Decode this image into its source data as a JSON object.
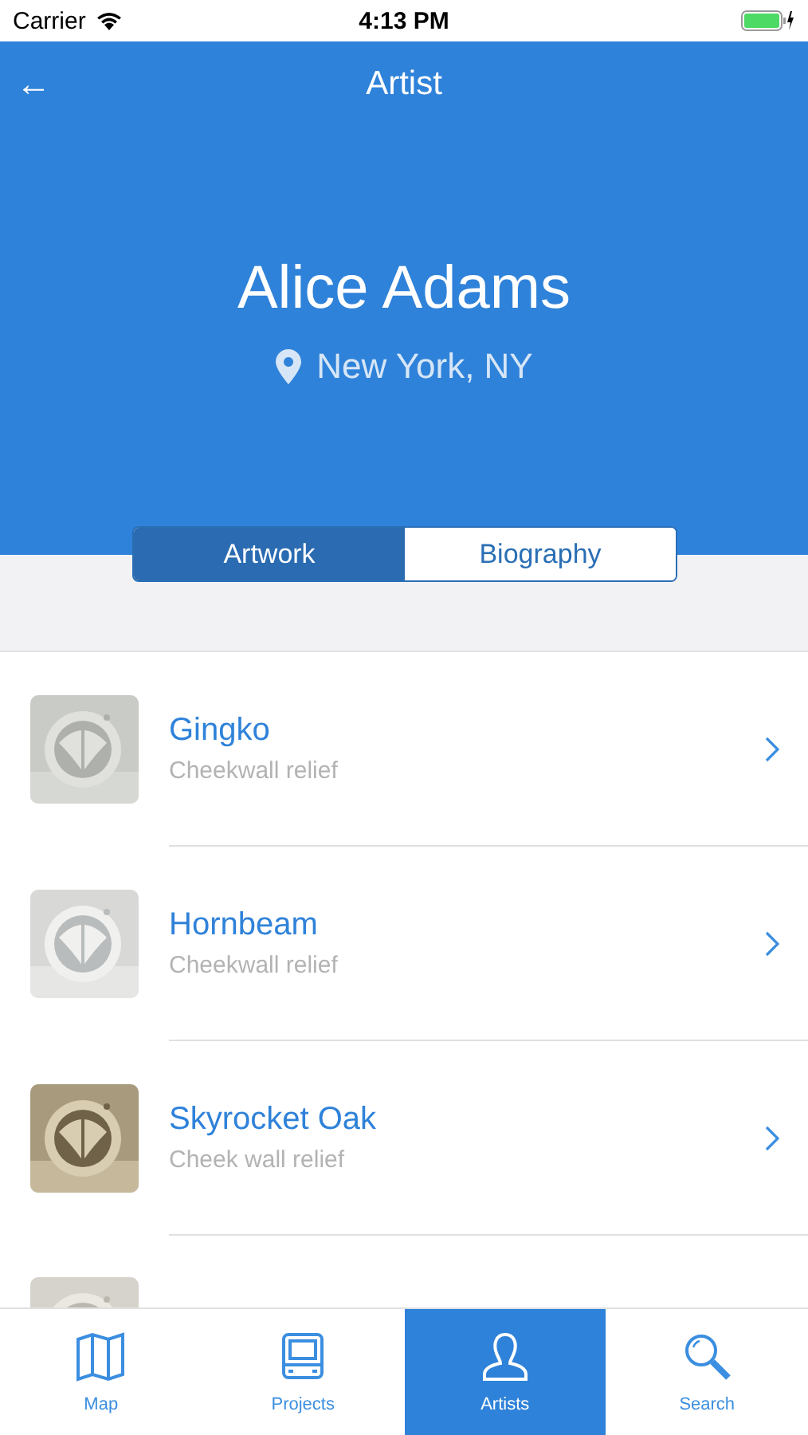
{
  "status_bar": {
    "carrier": "Carrier",
    "time": "4:13 PM"
  },
  "nav": {
    "back": "←",
    "title": "Artist"
  },
  "artist": {
    "name": "Alice Adams",
    "location": "New York, NY"
  },
  "segments": [
    {
      "label": "Artwork",
      "selected": true
    },
    {
      "label": "Biography",
      "selected": false
    }
  ],
  "artworks": [
    {
      "kind": "row",
      "title": "Gingko",
      "subtitle": "Cheekwall relief"
    },
    {
      "kind": "row",
      "title": "Hornbeam",
      "subtitle": "Cheekwall relief"
    },
    {
      "kind": "row",
      "title": "Skyrocket Oak",
      "subtitle": "Cheek wall relief"
    },
    {
      "kind": "partial"
    }
  ],
  "tab_bar": [
    {
      "label": "Map",
      "kind": "map",
      "selected": false
    },
    {
      "label": "Projects",
      "kind": "bus",
      "selected": false
    },
    {
      "label": "Artists",
      "kind": "person",
      "selected": true
    },
    {
      "label": "Search",
      "kind": "search",
      "selected": false
    }
  ]
}
